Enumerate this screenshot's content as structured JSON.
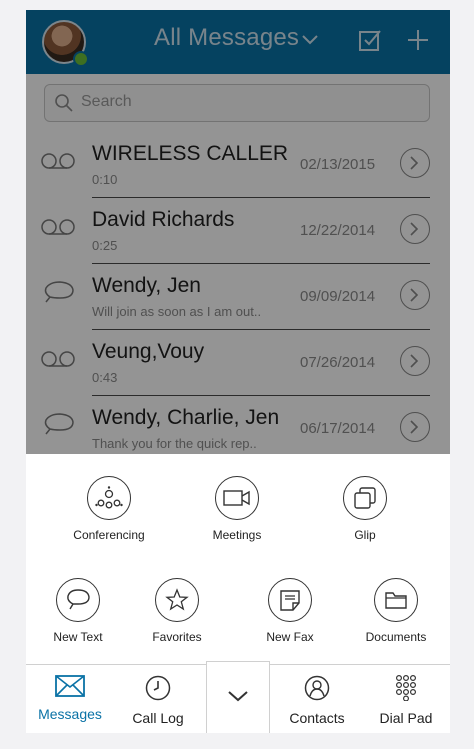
{
  "header": {
    "title": "All Messages",
    "accent_color": "#0a72a6"
  },
  "search": {
    "placeholder": "Search"
  },
  "messages": [
    {
      "type": "voicemail",
      "name": "WIRELESS CALLER",
      "sub": "0:10",
      "date": "02/13/2015"
    },
    {
      "type": "voicemail",
      "name": "David Richards",
      "sub": "0:25",
      "date": "12/22/2014"
    },
    {
      "type": "text",
      "name": "Wendy, Jen",
      "sub": "Will join as soon as I am out..",
      "date": "09/09/2014"
    },
    {
      "type": "voicemail",
      "name": "Veung,Vouy",
      "sub": "0:43",
      "date": "07/26/2014"
    },
    {
      "type": "text",
      "name": "Wendy, Charlie, Jen",
      "sub": "Thank you for  the quick rep..",
      "date": "06/17/2014"
    }
  ],
  "actions_row1": [
    {
      "label": "Conferencing",
      "icon": "conference-icon"
    },
    {
      "label": "Meetings",
      "icon": "video-camera-icon"
    },
    {
      "label": "Glip",
      "icon": "glip-icon"
    }
  ],
  "actions_row2": [
    {
      "label": "New Text",
      "icon": "chat-bubble-icon"
    },
    {
      "label": "Favorites",
      "icon": "star-icon"
    },
    {
      "label": "New Fax",
      "icon": "fax-icon"
    },
    {
      "label": "Documents",
      "icon": "folder-icon"
    }
  ],
  "tabs": [
    {
      "label": "Messages",
      "icon": "envelope-icon",
      "active": true
    },
    {
      "label": "Call Log",
      "icon": "clock-icon",
      "active": false
    },
    {
      "label": "Contacts",
      "icon": "contact-icon",
      "active": false
    },
    {
      "label": "Dial Pad",
      "icon": "dialpad-icon",
      "active": false
    }
  ]
}
